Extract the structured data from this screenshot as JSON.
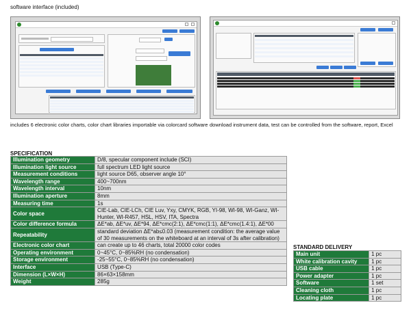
{
  "top_label": "software interface (included)",
  "left_shot": {
    "window_title": "Colorimeter Software",
    "buttons": [
      "English",
      "Exit"
    ],
    "meter_info_label": "Meter Information",
    "meter_model_label": "Meter Model",
    "meter_model_value": "CR8-LS10",
    "color_card_library_label": "Color Card Library Set",
    "add_card_button": "Add Color Card Library",
    "card_measure_label": "Color Card Measure",
    "card_library_name_label": "Color Card library Name",
    "card_library_name_value": "All files",
    "export_button": "Export",
    "card_number_label": "Color Card Number",
    "color_values_label": "Color Values",
    "color_values": [
      "L 50.33",
      "a -20.00",
      "b 10.20"
    ],
    "measure_button": "Measure",
    "color_patches_label": "Color Patches",
    "table_header": [
      "Color Card Name",
      "L",
      "a",
      "b",
      "Selected"
    ],
    "bottom_buttons": [
      "Delete All Color Card",
      "Import Color Card",
      "Add Color Card",
      "Delete Color Card",
      "Import Color Card Library"
    ]
  },
  "right_shot": {
    "window_title": "Colorimeter Software",
    "buttons": [
      "Connect",
      "Exit"
    ],
    "side_buttons": [
      "Save Excel",
      "Export Report"
    ],
    "mid_buttons": [
      "Delete All",
      "Excel",
      "Report"
    ]
  },
  "caption_left": "includes 6 electronic color charts, color chart libraries importable via colorcard software",
  "caption_right": "download instrument data, test can be controlled from the software, report, Excel",
  "spec_heading": "SPECIFICATION",
  "spec": [
    {
      "k": "Illumination geometry",
      "v": "D/8, specular component include (SCI)"
    },
    {
      "k": "Illumination light source",
      "v": "full spectrum LED light source"
    },
    {
      "k": "Measurement conditions",
      "v": "light source D65, observer angle 10°"
    },
    {
      "k": "Wavelength range",
      "v": "400~700nm"
    },
    {
      "k": "Wavelength interval",
      "v": "10nm"
    },
    {
      "k": "Illumination aperture",
      "v": "8mm"
    },
    {
      "k": "Measuring time",
      "v": "1s"
    },
    {
      "k": "Color space",
      "v": "CIE-Lab, CIE-LCh, CIE Luv, Yxy, CMYK, RGB, YI-98, WI-98, WI-Ganz, WI-Hunter, WI-R457, HSL, HSV, ITA, Spectra"
    },
    {
      "k": "Color difference formula",
      "v": "ΔE*ab, ΔE*uv, ΔE*94, ΔE*cmc(2:1), ΔE*cmc(1:1), ΔE*cmc(1.4:1), ΔE*00"
    },
    {
      "k": "Repeatability",
      "v": "standard deviation ΔE*ab≤0.03 (measurement condition: the average value of 30 measurements on the whiteboard at an interval of 3s after calibration)"
    },
    {
      "k": "Electronic color chart",
      "v": "can create up to 46 charts, total 20000 color codes"
    },
    {
      "k": "Operating environment",
      "v": "0~45°C, 0~85%RH (no condensation)"
    },
    {
      "k": "Storage environment",
      "v": "-25~55°C, 0~85%RH (no condensation)"
    },
    {
      "k": "Interface",
      "v": "USB (Type-C)"
    },
    {
      "k": "Dimension (L×W×H)",
      "v": "86×63×158mm"
    },
    {
      "k": "Weight",
      "v": "285g"
    }
  ],
  "delivery_heading": "STANDARD DELIVERY",
  "delivery": [
    {
      "k": "Main unit",
      "v": "1 pc"
    },
    {
      "k": "White calibration cavity",
      "v": "1 pc"
    },
    {
      "k": "USB cable",
      "v": "1 pc"
    },
    {
      "k": "Power adapter",
      "v": "1 pc"
    },
    {
      "k": "Software",
      "v": "1 set"
    },
    {
      "k": "Cleaning cloth",
      "v": "1 pc"
    },
    {
      "k": "Locating plate",
      "v": "1 pc"
    }
  ]
}
